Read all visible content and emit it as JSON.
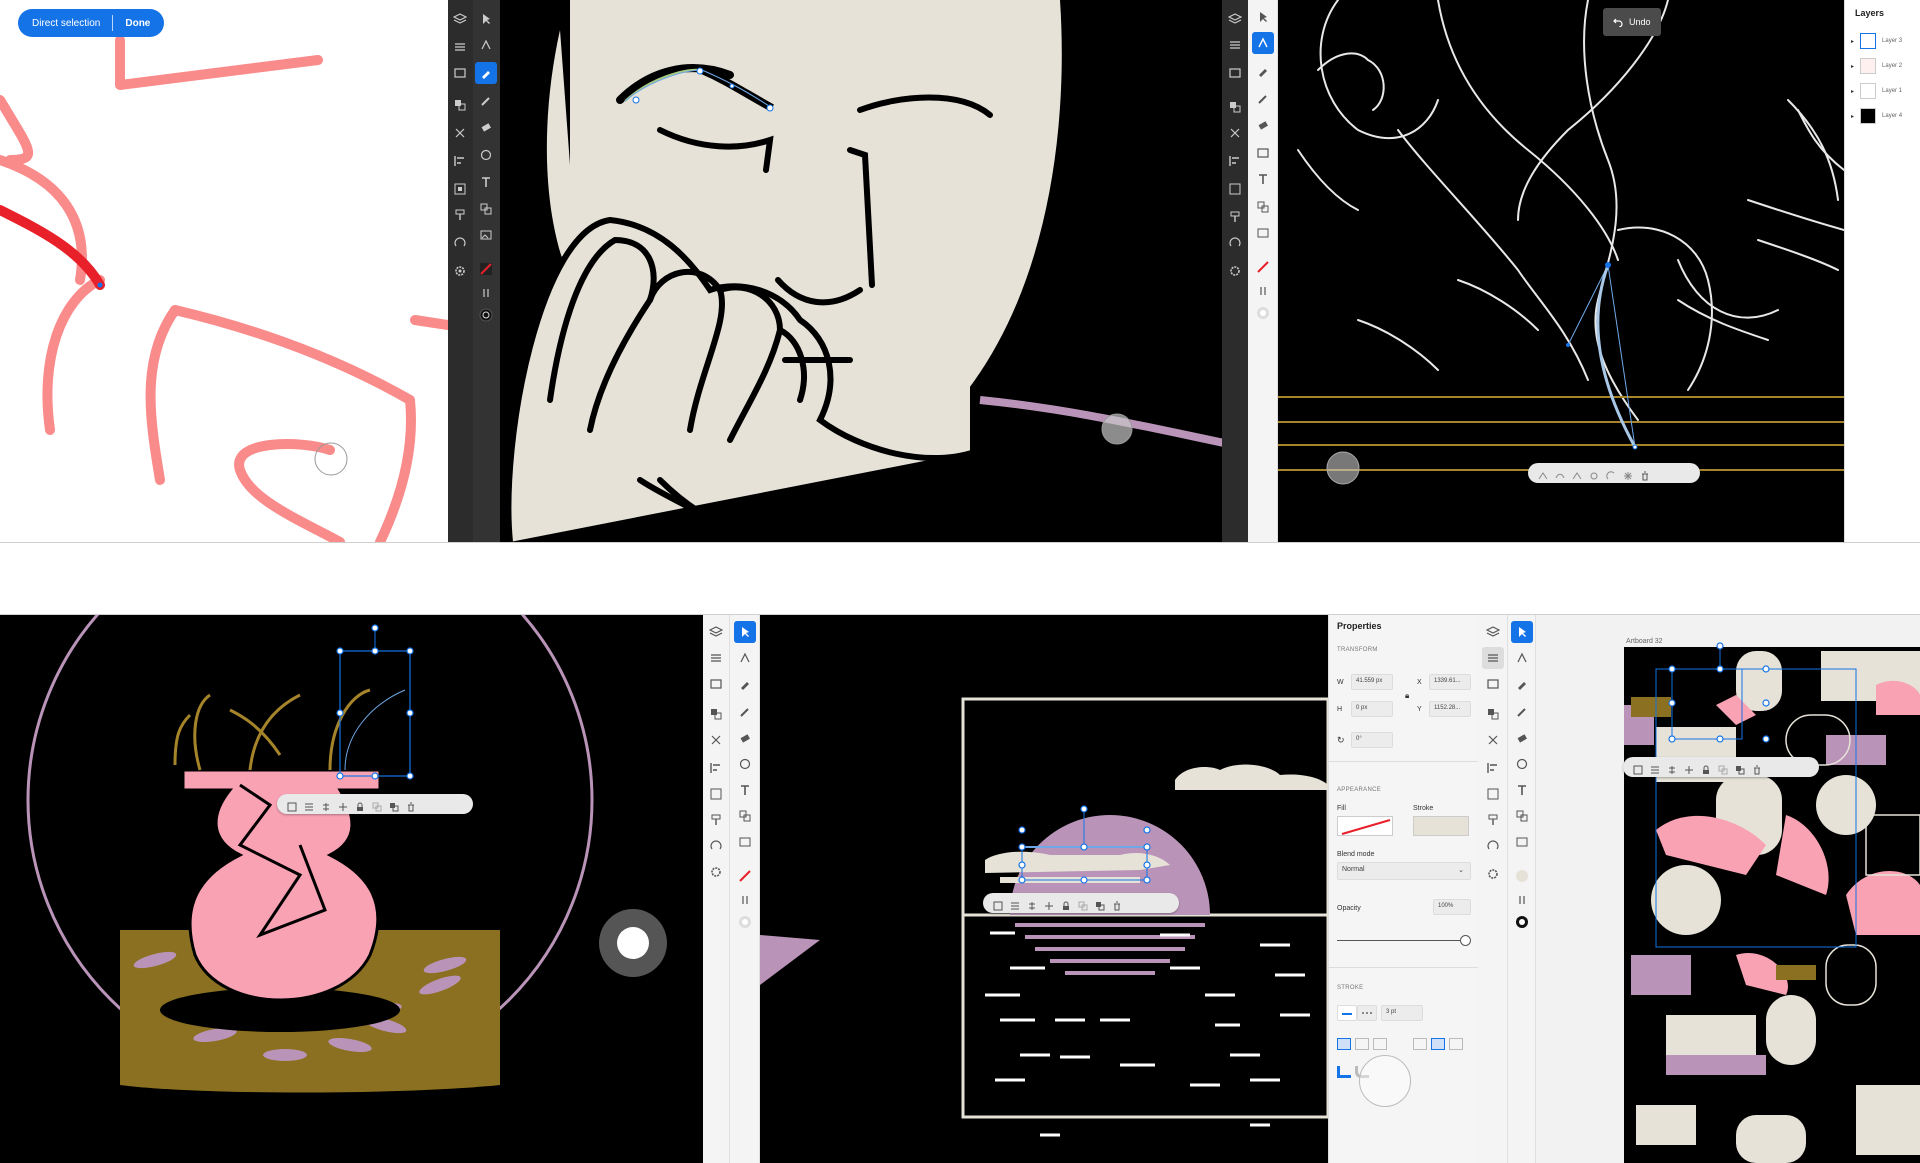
{
  "top_left": {
    "selection_pill": {
      "mode_label": "Direct selection",
      "done_label": "Done"
    }
  },
  "top_right": {
    "undo_label": "Undo",
    "layers_panel": {
      "title": "Layers",
      "items": [
        {
          "label": "Layer 3"
        },
        {
          "label": "Layer 2"
        },
        {
          "label": "Layer 1"
        },
        {
          "label": "Layer 4"
        }
      ]
    }
  },
  "bottom_middle": {
    "properties": {
      "title": "Properties",
      "transform_heading": "TRANSFORM",
      "w_label": "W",
      "w_value": "41.559 px",
      "x_label": "X",
      "x_value": "1339.61...",
      "h_label": "H",
      "h_value": "0 px",
      "y_label": "Y",
      "y_value": "1152.28...",
      "rotation_value": "0°",
      "appearance_heading": "APPEARANCE",
      "fill_label": "Fill",
      "stroke_label": "Stroke",
      "blend_label": "Blend mode",
      "blend_value": "Normal",
      "opacity_label": "Opacity",
      "opacity_value": "100%",
      "stroke_heading": "STROKE",
      "stroke_width_value": "3 pt"
    }
  },
  "bottom_right": {
    "artboard_label": "Artboard 32"
  },
  "colors": {
    "accent": "#1473e6",
    "toolbar_dark": "#2c2c2c",
    "pink": "#f8a2b4",
    "red_stroke": "#e8202a",
    "cream": "#e6e2d8",
    "gold": "#a5842a",
    "lilac": "#b994b8"
  }
}
